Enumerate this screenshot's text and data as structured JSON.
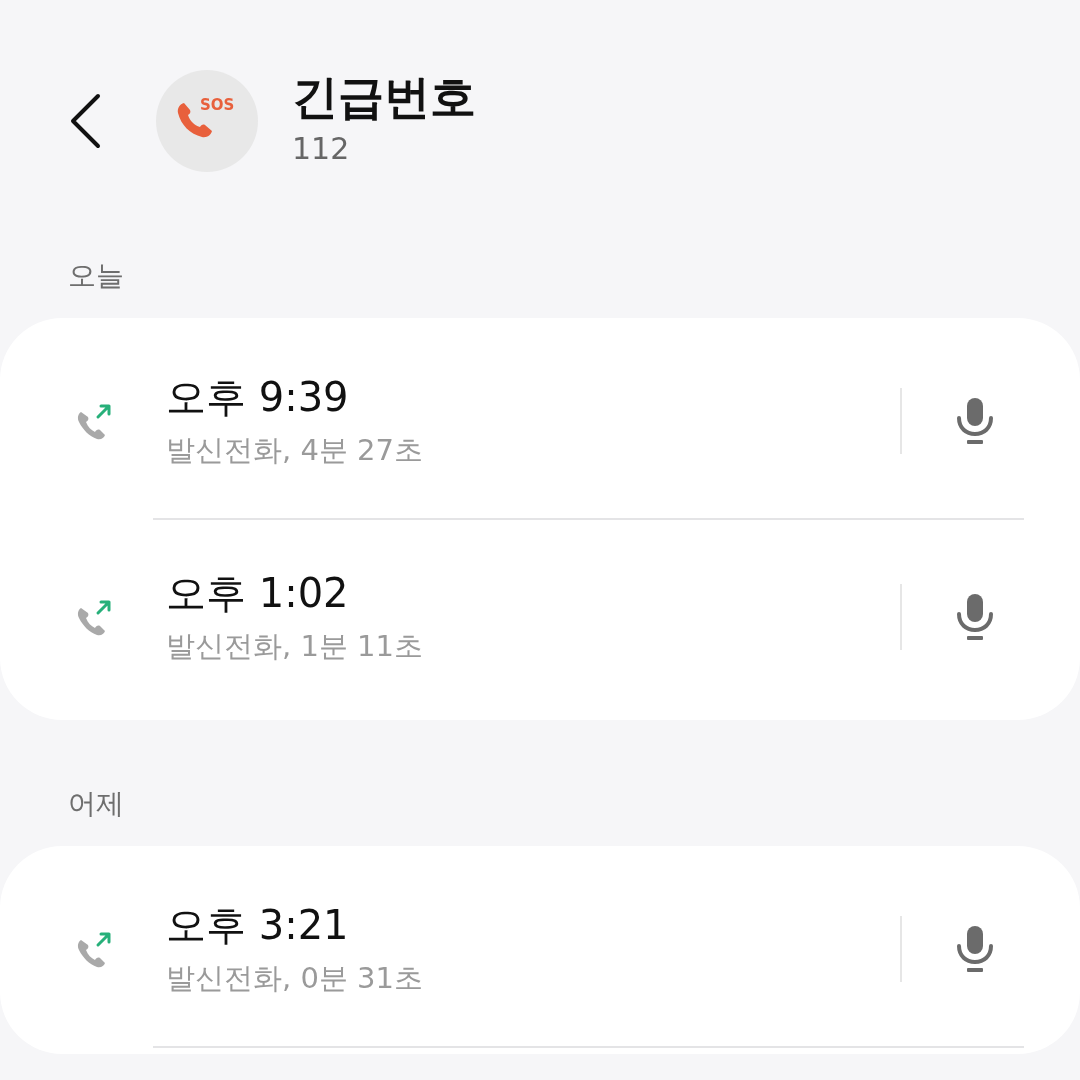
{
  "contact": {
    "name": "긴급번호",
    "number": "112",
    "badge": "SOS"
  },
  "groups": [
    {
      "label": "오늘",
      "continues": false,
      "calls": [
        {
          "time": "오후 9:39",
          "detail": "발신전화, 4분 27초",
          "kind": "outgoing",
          "recorded": true
        },
        {
          "time": "오후 1:02",
          "detail": "발신전화, 1분 11초",
          "kind": "outgoing",
          "recorded": true
        }
      ]
    },
    {
      "label": "어제",
      "continues": true,
      "calls": [
        {
          "time": "오후 3:21",
          "detail": "발신전화, 0분 31초",
          "kind": "outgoing",
          "recorded": true
        }
      ]
    }
  ]
}
